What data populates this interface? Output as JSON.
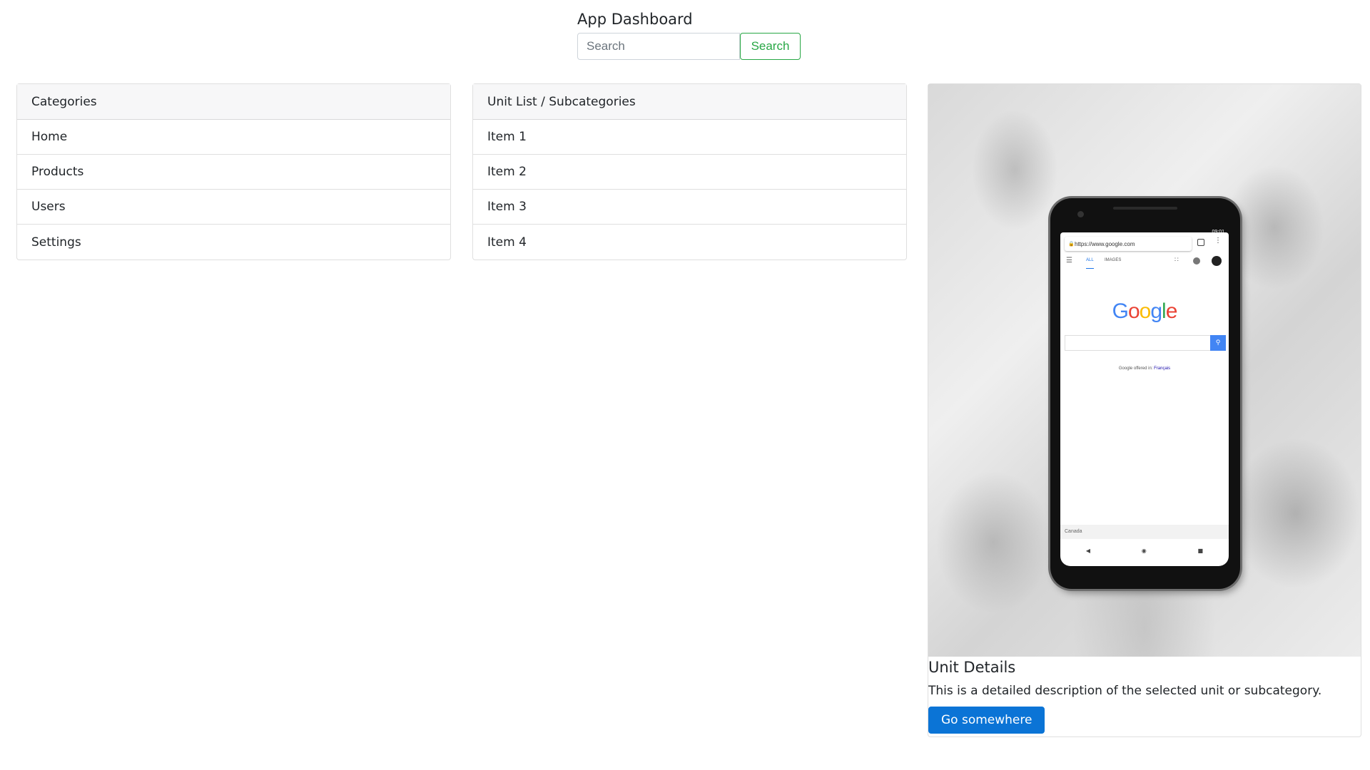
{
  "header": {
    "title": "App Dashboard",
    "search_placeholder": "Search",
    "search_button": "Search"
  },
  "categories": {
    "title": "Categories",
    "items": [
      "Home",
      "Products",
      "Users",
      "Settings"
    ]
  },
  "units": {
    "title": "Unit List / Subcategories",
    "items": [
      "Item 1",
      "Item 2",
      "Item 3",
      "Item 4"
    ]
  },
  "detail": {
    "title": "Unit Details",
    "text": "This is a detailed description of the selected unit or subcategory.",
    "button": "Go somewhere",
    "image": {
      "url": "https://www.google.com",
      "status_time": "09:01",
      "tab_all": "ALL",
      "tab_images": "IMAGES",
      "logo": "Google",
      "offered_label": "Google offered in:",
      "offered_language": "Français",
      "footer_country": "Canada"
    }
  },
  "colors": {
    "search_button": "#28a745",
    "primary_button": "#0b74d6",
    "panel_header_bg": "#f7f7f8"
  },
  "icons": {
    "lock": "lock-icon",
    "menu": "menu-icon",
    "apps": "apps-grid-icon",
    "search": "search-icon"
  }
}
